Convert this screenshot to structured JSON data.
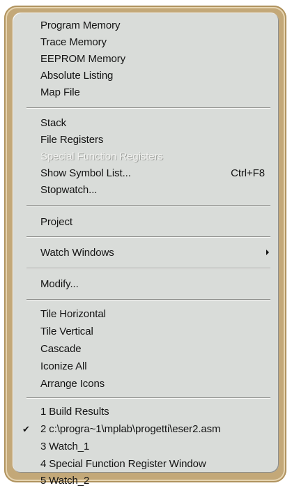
{
  "menu": {
    "groups": [
      [
        "Program Memory",
        "Trace Memory",
        "EEPROM Memory",
        "Absolute Listing",
        "Map File"
      ],
      [
        "Stack",
        "File Registers",
        "Special Function Registers",
        "Show Symbol List...",
        "Stopwatch..."
      ],
      [
        "Project"
      ],
      [
        "Watch Windows"
      ],
      [
        "Modify..."
      ],
      [
        "Tile Horizontal",
        "Tile Vertical",
        "Cascade",
        "Iconize All",
        "Arrange Icons"
      ],
      [
        "1 Build Results",
        "2 c:\\progra~1\\mplab\\progetti\\eser2.asm",
        "3 Watch_1",
        "4 Special Function Register Window",
        "5 Watch_2"
      ]
    ],
    "program_memory": "Program Memory",
    "trace_memory": "Trace Memory",
    "eeprom_memory": "EEPROM Memory",
    "absolute_listing": "Absolute Listing",
    "map_file": "Map File",
    "stack": "Stack",
    "file_registers": "File Registers",
    "special_function_registers": "Special Function Registers",
    "special_function_registers_enabled": false,
    "show_symbol_list": "Show Symbol List...",
    "show_symbol_list_shortcut": "Ctrl+F8",
    "stopwatch": "Stopwatch...",
    "project": "Project",
    "watch_windows": "Watch Windows",
    "modify": "Modify...",
    "tile_horizontal": "Tile Horizontal",
    "tile_vertical": "Tile Vertical",
    "cascade": "Cascade",
    "iconize_all": "Iconize All",
    "arrange_icons": "Arrange Icons",
    "window_1": "1 Build Results",
    "window_2": "2 c:\\progra~1\\mplab\\progetti\\eser2.asm",
    "window_2_checked": true,
    "window_3": "3 Watch_1",
    "window_4": "4 Special Function Register Window",
    "window_5": "5 Watch_2"
  },
  "icons": {
    "checkmark": "check-icon",
    "submenu": "submenu-arrow-icon"
  },
  "colors": {
    "frame": "#c3a878",
    "menu_background": "#d9dcd9",
    "text": "#141414",
    "disabled_text": "#f1f1ef"
  }
}
